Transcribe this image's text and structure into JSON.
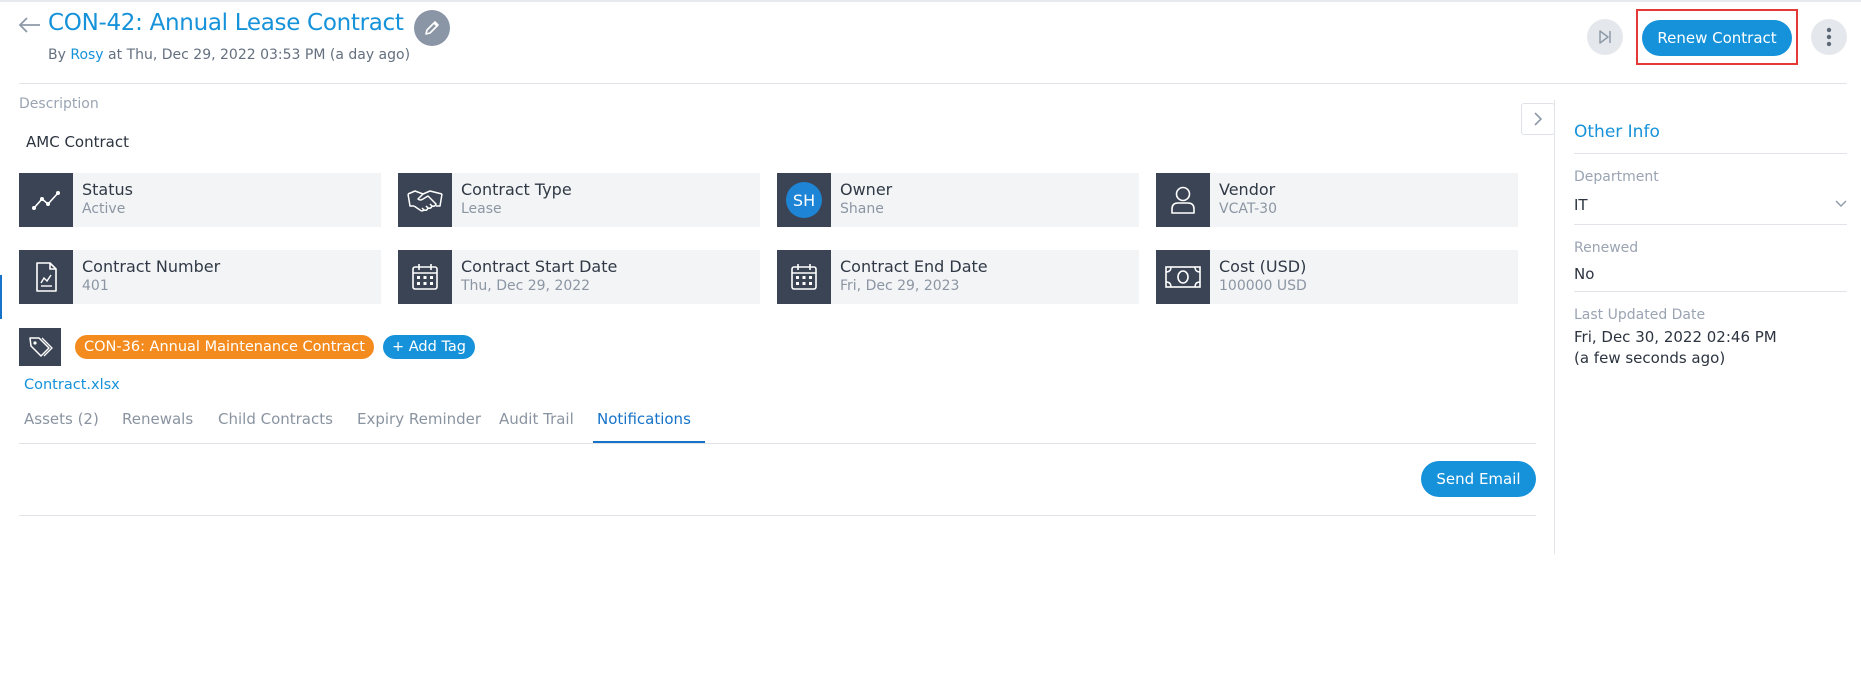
{
  "header": {
    "title": "CON-42: Annual Lease Contract",
    "by_prefix": "By",
    "author": "Rosy",
    "created_text": "at Thu, Dec 29, 2022 03:53 PM (a day ago)",
    "renew_label": "Renew Contract"
  },
  "description": {
    "label": "Description",
    "value": "AMC Contract"
  },
  "cards": [
    {
      "title": "Status",
      "value": "Active",
      "icon": "trend-line-icon"
    },
    {
      "title": "Contract Type",
      "value": "Lease",
      "icon": "handshake-icon"
    },
    {
      "title": "Owner",
      "value": "Shane",
      "avatar": "SH"
    },
    {
      "title": "Vendor",
      "value": "VCAT-30",
      "icon": "user-icon"
    },
    {
      "title": "Contract Number",
      "value": "401",
      "icon": "document-icon"
    },
    {
      "title": "Contract Start Date",
      "value": "Thu, Dec 29, 2022",
      "icon": "calendar-icon"
    },
    {
      "title": "Contract End Date",
      "value": "Fri, Dec 29, 2023",
      "icon": "calendar-icon"
    },
    {
      "title": "Cost (USD)",
      "value": "100000 USD",
      "icon": "banknote-icon"
    }
  ],
  "tags": {
    "items": [
      "CON-36: Annual Maintenance Contract"
    ],
    "add_label": "+ Add Tag"
  },
  "attachment": "Contract.xlsx",
  "tabs": [
    {
      "label": "Assets (2)"
    },
    {
      "label": "Renewals"
    },
    {
      "label": "Child Contracts"
    },
    {
      "label": "Expiry Reminder"
    },
    {
      "label": "Audit Trail"
    },
    {
      "label": "Notifications",
      "active": true
    }
  ],
  "notifications": {
    "send_email_label": "Send Email"
  },
  "sidebar": {
    "title": "Other Info",
    "department_label": "Department",
    "department_value": "IT",
    "renewed_label": "Renewed",
    "renewed_value": "No",
    "last_updated_label": "Last Updated Date",
    "last_updated_value": "Fri, Dec 30, 2022 02:46 PM",
    "last_updated_relative": "(a few seconds ago)"
  },
  "colors": {
    "accent": "#1592d9",
    "tag": "#f48b1f",
    "icon_bg": "#3a4454",
    "highlight": "#e53935"
  }
}
